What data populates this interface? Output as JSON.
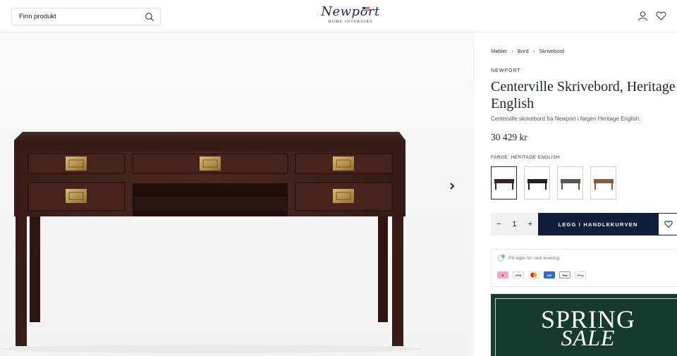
{
  "header": {
    "search_label": "Finn produkt",
    "logo_text": "Newport",
    "logo_subtext": "HOME INTERIORS",
    "account_icon": "user-icon",
    "wishlist_icon": "heart-icon"
  },
  "breadcrumb": [
    "Møbler",
    "Bord",
    "Skrivebord"
  ],
  "product": {
    "brand": "NEWPORT",
    "title": "Centerville Skrivebord, Heritage English",
    "description": "Centerville skrivebord fra Newport i fargen Heritage English.",
    "price": "30 429 kr",
    "color_label": "FARGE: HERITAGE ENGLISH",
    "swatches": [
      {
        "color": "#3a2420"
      },
      {
        "color": "#222222"
      },
      {
        "color": "#5b564c"
      },
      {
        "color": "#8a5a3c"
      }
    ]
  },
  "cart": {
    "minus": "−",
    "quantity": "1",
    "plus": "+",
    "add_label": "LEGG I HANDLEKURVEN"
  },
  "stock": {
    "text": "På lager for rask levering"
  },
  "payments": [
    {
      "name": "Klarna",
      "color": "#f4a6c4"
    },
    {
      "name": "VISA",
      "color": "#ffffff"
    },
    {
      "name": "Mastercard",
      "color": "#ffffff"
    },
    {
      "name": "Amex",
      "color": "#2b6cc4"
    },
    {
      "name": "Apple Pay",
      "color": "#ffffff"
    },
    {
      "name": "G Pay",
      "color": "#ffffff"
    }
  ],
  "banner": {
    "line1": "SPRING",
    "line2": "SALE"
  },
  "colors": {
    "navy": "#0f1e3a",
    "sale_green": "#173a2e",
    "desk_wood": "#3b1f1a"
  }
}
